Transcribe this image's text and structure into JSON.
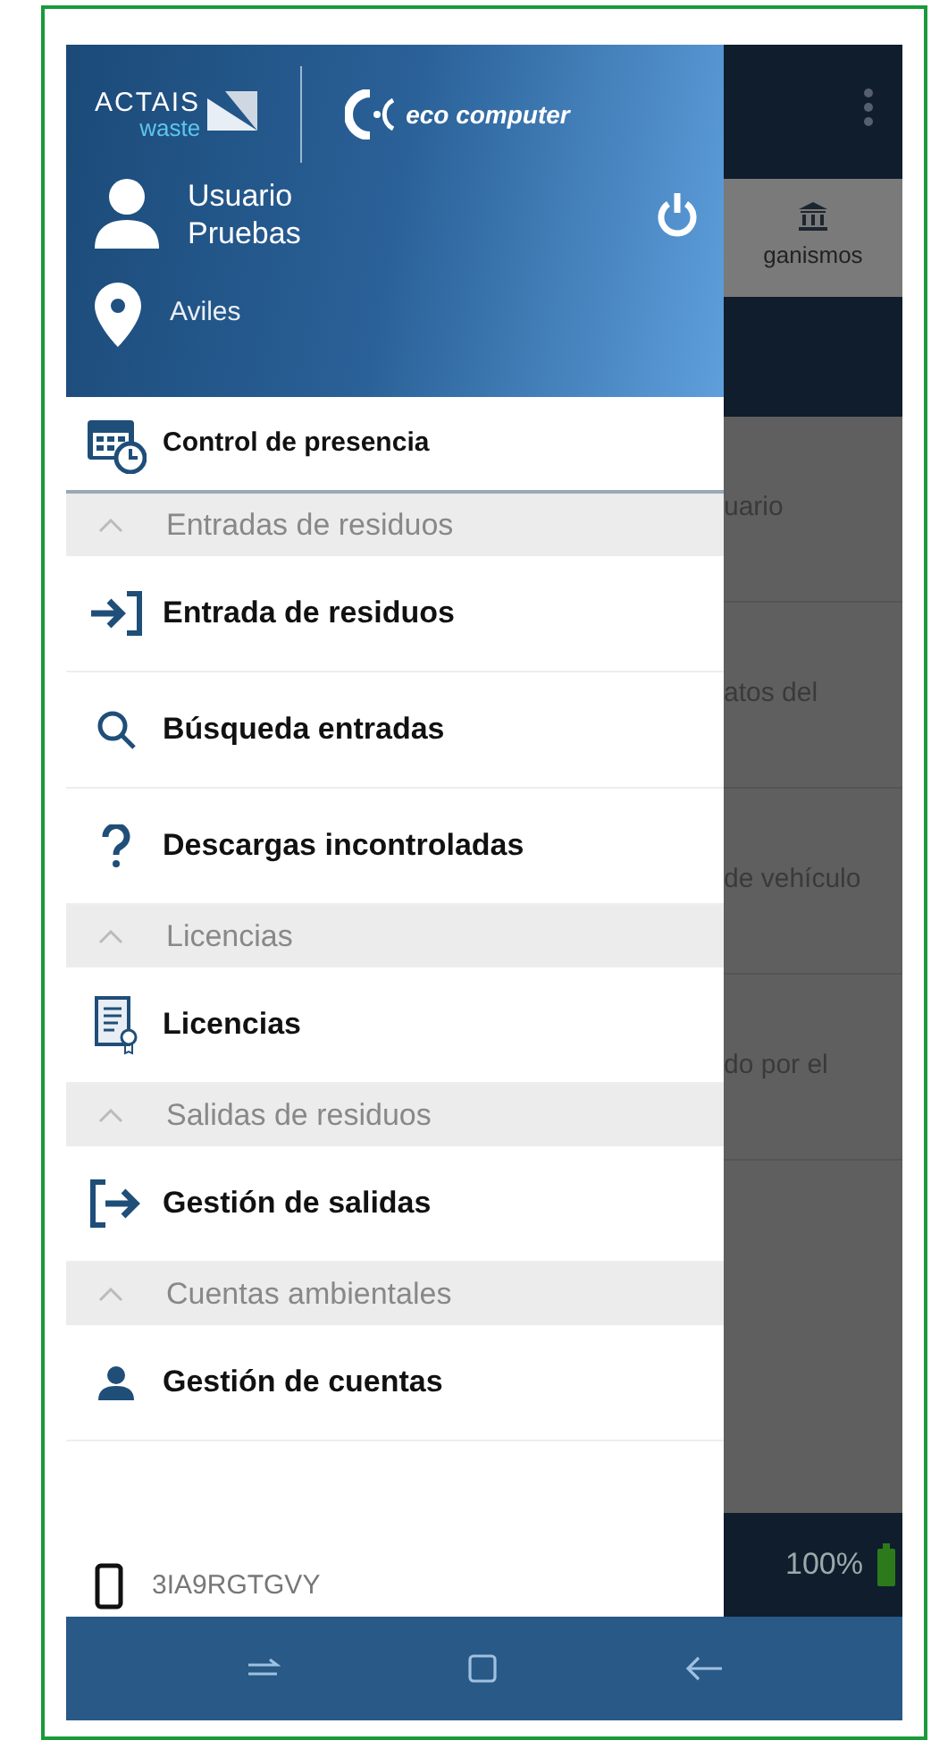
{
  "drawer": {
    "logos": [
      {
        "kind": "actais",
        "name": "ACTAIS",
        "sub": "waste"
      },
      {
        "kind": "eco",
        "name": "eco computer"
      }
    ],
    "user": {
      "name": "Usuario Pruebas"
    },
    "location": "Aviles",
    "menu": [
      {
        "kind": "item",
        "label": "Control de presencia"
      },
      {
        "kind": "section",
        "label": "Entradas de residuos",
        "expanded": true
      },
      {
        "kind": "item",
        "label": "Entrada de residuos"
      },
      {
        "kind": "item",
        "label": "Búsqueda entradas"
      },
      {
        "kind": "item",
        "label": "Descargas incontroladas"
      },
      {
        "kind": "section",
        "label": "Licencias",
        "expanded": true
      },
      {
        "kind": "item",
        "label": "Licencias"
      },
      {
        "kind": "section",
        "label": "Salidas de residuos",
        "expanded": true
      },
      {
        "kind": "item",
        "label": "Gestión de salidas"
      },
      {
        "kind": "section",
        "label": "Cuentas ambientales",
        "expanded": true
      },
      {
        "kind": "item",
        "label": "Gestión de cuentas"
      }
    ],
    "device_id": "3IA9RGTGVY"
  },
  "background_screen": {
    "tab_label": "ganismos",
    "rows": [
      "uario",
      "atos del",
      "de vehículo",
      "do por el"
    ],
    "battery_reading": "100%"
  }
}
